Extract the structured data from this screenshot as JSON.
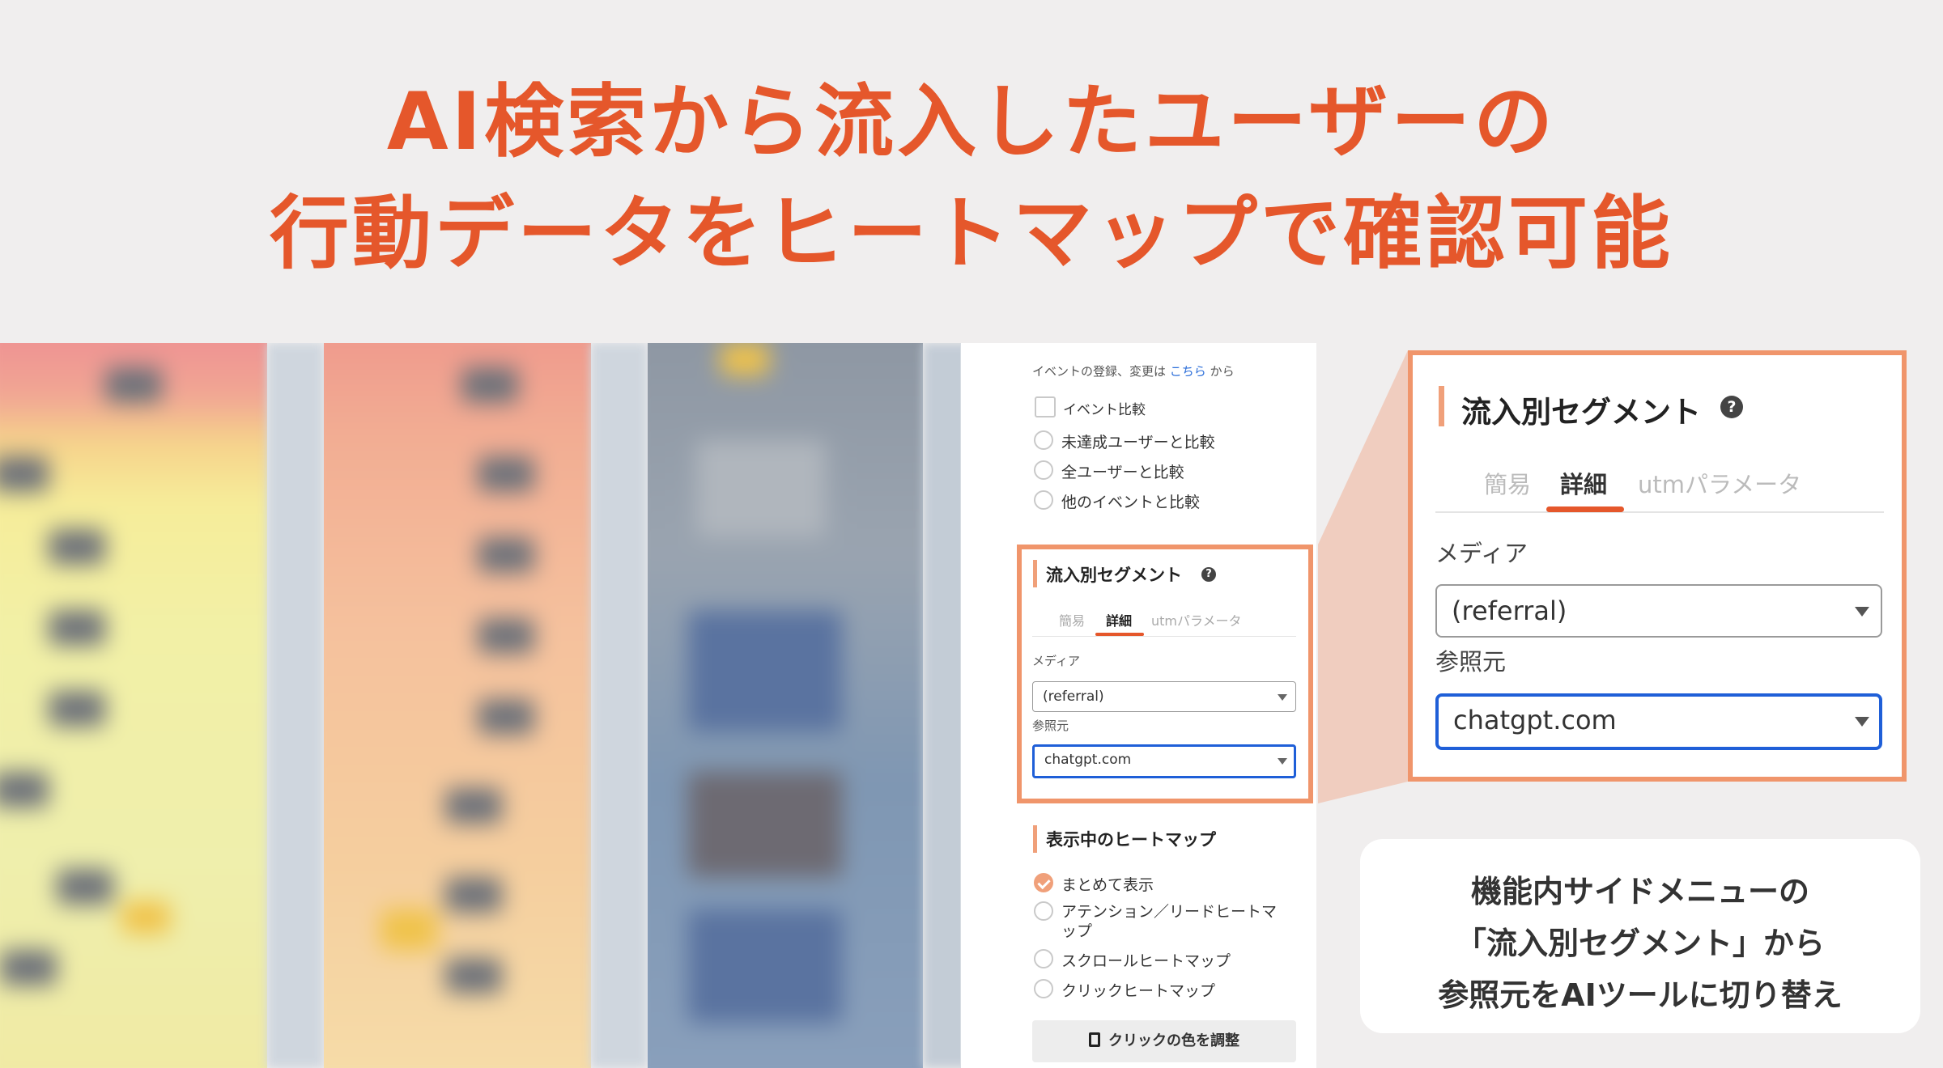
{
  "headline": {
    "line1": "AI検索から流入したユーザーの",
    "line2": "行動データをヒートマップで確認可能"
  },
  "colors": {
    "accent": "#e5572b",
    "highlight_border": "#f0956b",
    "focus_blue": "#1f5fd8"
  },
  "panel": {
    "event_note": {
      "prefix": "イベントの登録、変更は ",
      "link": "こちら",
      "suffix": " から"
    },
    "event_compare": {
      "checkbox_label": "イベント比較",
      "options": [
        "未達成ユーザーと比較",
        "全ユーザーと比較",
        "他のイベントと比較"
      ]
    },
    "segment": {
      "title": "流入別セグメント",
      "help_icon": "question-circle-icon",
      "tabs": [
        "簡易",
        "詳細",
        "utmパラメータ"
      ],
      "active_tab": "詳細",
      "media_label": "メディア",
      "media_value": "(referral)",
      "referrer_label": "参照元",
      "referrer_value": "chatgpt.com"
    },
    "heatmap_section": {
      "title": "表示中のヒートマップ",
      "options": [
        "まとめて表示",
        "アテンション／リードヒートマップ",
        "スクロールヒートマップ",
        "クリックヒートマップ"
      ],
      "option2_line1": "アテンション／リードヒートマ",
      "option2_line2": "ップ",
      "selected": "まとめて表示"
    },
    "adjust_button": {
      "icon": "paint-roller-icon",
      "label": "クリックの色を調整"
    }
  },
  "zoom": {
    "title": "流入別セグメント",
    "tabs": [
      "簡易",
      "詳細",
      "utmパラメータ"
    ],
    "media_label": "メディア",
    "media_value": "(referral)",
    "referrer_label": "参照元",
    "referrer_value": "chatgpt.com"
  },
  "caption": {
    "line1": "機能内サイドメニューの",
    "line2": "「流入別セグメント」から",
    "line3": "参照元をAIツールに切り替え"
  }
}
